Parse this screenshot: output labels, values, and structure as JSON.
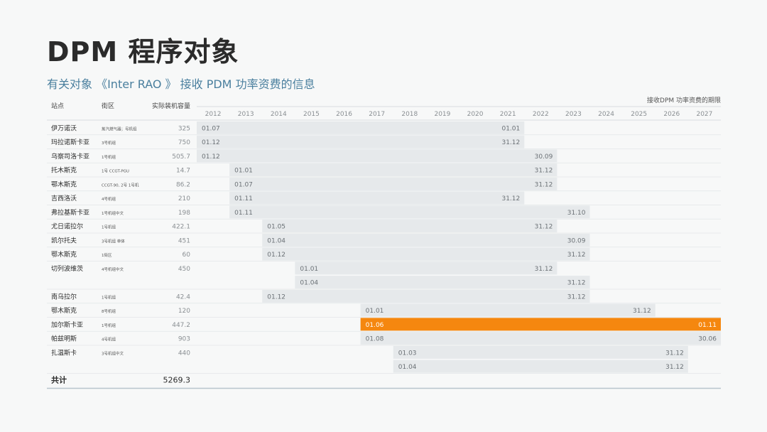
{
  "header": {
    "title": "DPM 程序对象",
    "subtitle": "有关对象 《Inter RAO 》 接收 PDM 功率资费的信息"
  },
  "chart_data": {
    "type": "gantt",
    "period_label": "接收DPM 功率资费的期限",
    "columns": {
      "station": "站点",
      "unit": "街区",
      "capacity": "实际装机容量"
    },
    "years": [
      "2012",
      "2013",
      "2014",
      "2015",
      "2016",
      "2017",
      "2018",
      "2019",
      "2020",
      "2021",
      "2022",
      "2023",
      "2024",
      "2025",
      "2026",
      "2027"
    ],
    "rows": [
      {
        "station": "伊万诺沃",
        "unit": "蒸汽燃气器；号机组",
        "capacity": "325",
        "bars": [
          {
            "start": "01.07",
            "end": "01.01",
            "start_year": 2012.0,
            "end_year": 2022.0,
            "highlight": false
          }
        ]
      },
      {
        "station": "玛拉诺斯卡亚",
        "unit": "3号机组",
        "capacity": "750",
        "bars": [
          {
            "start": "01.12",
            "end": "31.12",
            "start_year": 2012.0,
            "end_year": 2022.0,
            "highlight": false
          }
        ]
      },
      {
        "station": "乌察司洛卡亚",
        "unit": "1号机组",
        "capacity": "505.7",
        "bars": [
          {
            "start": "01.12",
            "end": "30.09",
            "start_year": 2012.0,
            "end_year": 2023.0,
            "highlight": false
          }
        ]
      },
      {
        "station": "托木斯克",
        "unit": "1号 CCGT-PGU",
        "capacity": "14.7",
        "bars": [
          {
            "start": "01.01",
            "end": "31.12",
            "start_year": 2013.0,
            "end_year": 2023.0,
            "highlight": false
          }
        ]
      },
      {
        "station": "鄂木斯克",
        "unit": "CCGT-90, 2号 1号机",
        "capacity": "86.2",
        "bars": [
          {
            "start": "01.07",
            "end": "31.12",
            "start_year": 2013.0,
            "end_year": 2023.0,
            "highlight": false
          }
        ]
      },
      {
        "station": "吉西洛沃",
        "unit": "4号机组",
        "capacity": "210",
        "bars": [
          {
            "start": "01.11",
            "end": "31.12",
            "start_year": 2013.0,
            "end_year": 2022.0,
            "highlight": false
          }
        ]
      },
      {
        "station": "弗拉基斯卡亚",
        "unit": "1号机组中文",
        "capacity": "198",
        "bars": [
          {
            "start": "01.11",
            "end": "31.10",
            "start_year": 2013.0,
            "end_year": 2024.0,
            "highlight": false
          }
        ]
      },
      {
        "station": "尤日诺拉尔",
        "unit": "1号机组",
        "capacity": "422.1",
        "bars": [
          {
            "start": "01.05",
            "end": "31.12",
            "start_year": 2014.0,
            "end_year": 2023.0,
            "highlight": false
          }
        ]
      },
      {
        "station": "凯尔托夫",
        "unit": "3号机组 单体",
        "capacity": "451",
        "bars": [
          {
            "start": "01.04",
            "end": "30.09",
            "start_year": 2014.0,
            "end_year": 2024.0,
            "highlight": false
          }
        ]
      },
      {
        "station": "鄂木斯克",
        "unit": "1街区",
        "capacity": "60",
        "bars": [
          {
            "start": "01.12",
            "end": "31.12",
            "start_year": 2014.0,
            "end_year": 2024.0,
            "highlight": false
          }
        ]
      },
      {
        "station": "切列波维茨",
        "unit": "4号机组中文",
        "capacity": "450",
        "bars": [
          {
            "start": "01.01",
            "end": "31.12",
            "start_year": 2015.0,
            "end_year": 2023.0,
            "highlight": false
          },
          {
            "start": "01.04",
            "end": "31.12",
            "start_year": 2015.0,
            "end_year": 2024.0,
            "highlight": false
          }
        ]
      },
      {
        "station": "南乌拉尔",
        "unit": "1号机组",
        "capacity": "42.4",
        "bars": [
          {
            "start": "01.12",
            "end": "31.12",
            "start_year": 2014.0,
            "end_year": 2024.0,
            "highlight": false
          }
        ]
      },
      {
        "station": "鄂木斯克",
        "unit": "8号机组",
        "capacity": "120",
        "bars": [
          {
            "start": "01.01",
            "end": "31.12",
            "start_year": 2017.0,
            "end_year": 2026.0,
            "highlight": false
          }
        ]
      },
      {
        "station": "加尔斯卡亚",
        "unit": "1号机组",
        "capacity": "447.2",
        "bars": [
          {
            "start": "01.06",
            "end": "01.11",
            "start_year": 2017.0,
            "end_year": 2028.0,
            "highlight": true
          }
        ]
      },
      {
        "station": "帕兹明斯",
        "unit": "4号机组",
        "capacity": "903",
        "bars": [
          {
            "start": "01.08",
            "end": "30.06",
            "start_year": 2017.0,
            "end_year": 2028.0,
            "highlight": false
          }
        ]
      },
      {
        "station": "扎温斯卡",
        "unit": "3号机组中文",
        "capacity": "440",
        "bars": [
          {
            "start": "01.03",
            "end": "31.12",
            "start_year": 2018.0,
            "end_year": 2027.0,
            "highlight": false
          },
          {
            "start": "01.04",
            "end": "31.12",
            "start_year": 2018.0,
            "end_year": 2027.0,
            "highlight": false
          }
        ]
      }
    ],
    "total": {
      "label": "共计",
      "value": "5269.3"
    },
    "colors": {
      "bar": "#e6e9eb",
      "highlight": "#f5870f",
      "text": "#2a2a2a",
      "muted": "#8a8f93",
      "line": "#d9dde0",
      "accent": "#4a7f9e"
    }
  }
}
